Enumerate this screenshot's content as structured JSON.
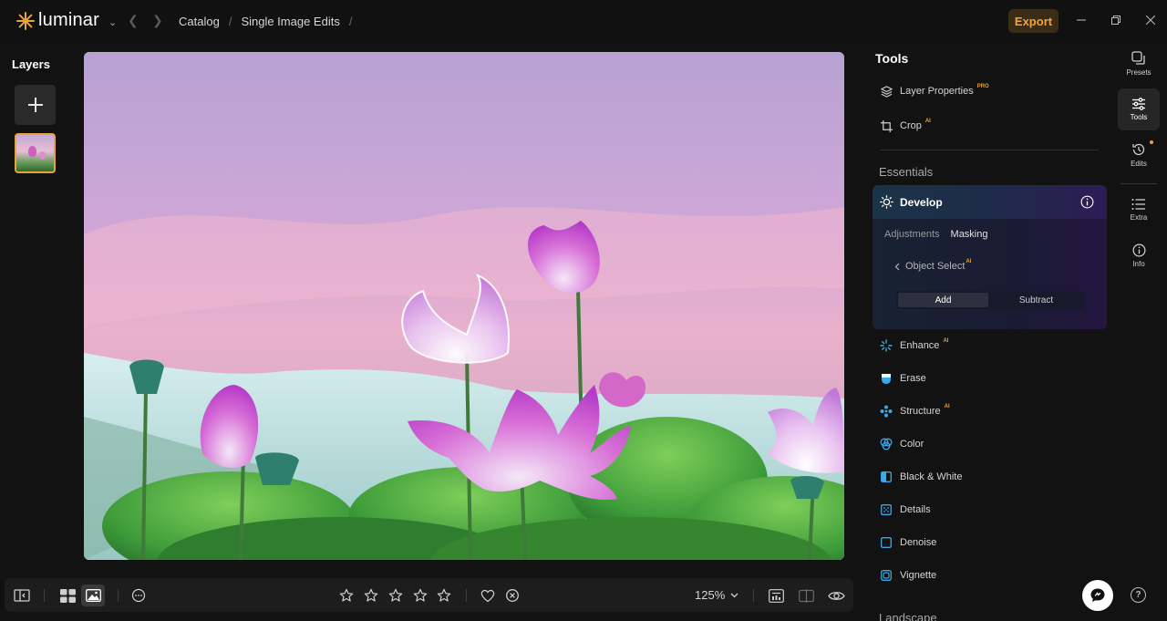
{
  "app": {
    "brand": "luminar",
    "brand_color": "#e8a33a"
  },
  "breadcrumb": {
    "items": [
      "Catalog",
      "Single Image Edits"
    ],
    "separator": "/"
  },
  "header": {
    "export_label": "Export",
    "window_controls": [
      "minimize-icon",
      "restore-icon",
      "close-icon"
    ]
  },
  "layers": {
    "title": "Layers",
    "add_icon": "plus-icon"
  },
  "bottom_toolbar": {
    "zoom": "125%",
    "rating_stars": 5,
    "icons": [
      "sidebar-toggle-icon",
      "grid-view-icon",
      "single-image-icon",
      "more-options-icon",
      "star-icon",
      "heart-icon",
      "reject-icon",
      "chevron-down-icon",
      "histogram-icon",
      "compare-icon",
      "eye-icon"
    ]
  },
  "tools": {
    "title": "Tools",
    "top_items": [
      {
        "label": "Layer Properties",
        "badge": "PRO",
        "icon": "layers-icon"
      },
      {
        "label": "Crop",
        "badge": "AI",
        "icon": "crop-icon"
      }
    ],
    "essentials_title": "Essentials",
    "develop": {
      "label": "Develop",
      "tabs": [
        "Adjustments",
        "Masking"
      ],
      "object_select": "Object Select",
      "object_select_badge": "AI",
      "segment": [
        "Add",
        "Subtract"
      ]
    },
    "items": [
      {
        "label": "Enhance",
        "badge": "AI",
        "icon": "enhance-icon"
      },
      {
        "label": "Erase",
        "badge": "",
        "icon": "erase-icon"
      },
      {
        "label": "Structure",
        "badge": "AI",
        "icon": "structure-icon"
      },
      {
        "label": "Color",
        "badge": "",
        "icon": "color-icon"
      },
      {
        "label": "Black & White",
        "badge": "",
        "icon": "black-white-icon"
      },
      {
        "label": "Details",
        "badge": "",
        "icon": "details-icon"
      },
      {
        "label": "Denoise",
        "badge": "",
        "icon": "denoise-icon"
      },
      {
        "label": "Vignette",
        "badge": "",
        "icon": "vignette-icon"
      }
    ],
    "landscape_title": "Landscape"
  },
  "rail": {
    "items": [
      {
        "label": "Presets",
        "icon": "presets-icon"
      },
      {
        "label": "Tools",
        "icon": "sliders-icon"
      },
      {
        "label": "Edits",
        "icon": "history-icon"
      },
      {
        "label": "Extra",
        "icon": "list-icon"
      },
      {
        "label": "Info",
        "icon": "info-icon"
      }
    ]
  }
}
